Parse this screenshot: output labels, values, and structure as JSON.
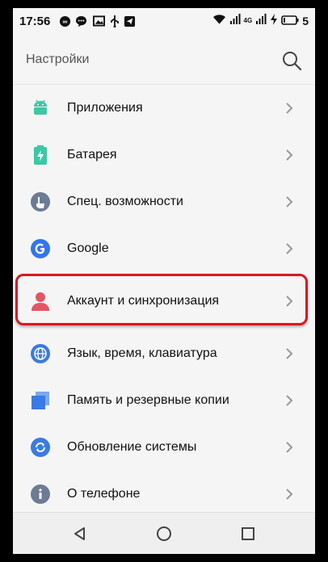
{
  "status_bar": {
    "time": "17:56",
    "network": "4G",
    "battery": "5"
  },
  "app_bar": {
    "title": "Настройки",
    "search_icon": "search-icon"
  },
  "settings_items": [
    {
      "label": "Приложения",
      "icon": "apps-icon",
      "color": "#3dc8a4"
    },
    {
      "label": "Батарея",
      "icon": "battery-icon",
      "color": "#3dc8a4"
    },
    {
      "label": "Спец. возможности",
      "icon": "accessibility-icon",
      "color": "#6d7b95"
    },
    {
      "label": "Google",
      "icon": "google-icon",
      "color": "#3476e8"
    },
    {
      "label": "Аккаунт и синхронизация",
      "icon": "account-icon",
      "color": "#e45563"
    },
    {
      "label": "Язык, время, клавиатура",
      "icon": "language-icon",
      "color": "#3a7be3"
    },
    {
      "label": "Память и резервные копии",
      "icon": "storage-icon",
      "color": "#3a7be3"
    },
    {
      "label": "Обновление системы",
      "icon": "update-icon",
      "color": "#3a7be3"
    },
    {
      "label": "О телефоне",
      "icon": "info-icon",
      "color": "#6d7b95"
    }
  ],
  "highlight_color": "#d71920"
}
